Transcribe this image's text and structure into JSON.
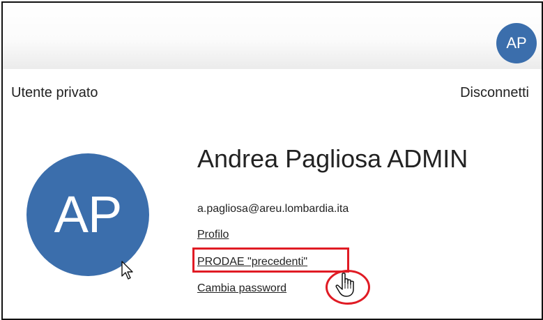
{
  "header": {
    "avatar_initials": "AP"
  },
  "session": {
    "user_type": "Utente privato",
    "logout_label": "Disconnetti"
  },
  "profile": {
    "avatar_initials": "AP",
    "name": "Andrea Pagliosa ADMIN",
    "email": "a.pagliosa@areu.lombardia.ita",
    "links": {
      "profile": "Profilo",
      "prodae_previous": "PRODAE \"precedenti\"",
      "change_password": "Cambia password"
    }
  },
  "colors": {
    "avatar_bg": "#3b6eac",
    "highlight": "#e01b24"
  },
  "icons": {
    "arrow_cursor": "mouse-pointer-arrow",
    "hand_cursor": "mouse-pointer-hand"
  }
}
